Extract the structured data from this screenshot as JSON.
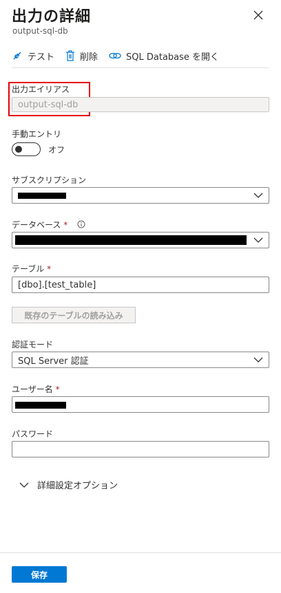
{
  "header": {
    "title": "出力の詳細",
    "subtitle": "output-sql-db"
  },
  "toolbar": {
    "test_label": "テスト",
    "delete_label": "削除",
    "open_db_label": "SQL Database を開く"
  },
  "output_alias": {
    "label": "出力エイリアス",
    "value": "output-sql-db"
  },
  "manual_entry": {
    "label": "手動エントリ",
    "state": "オフ"
  },
  "subscription": {
    "label": "サブスクリプション"
  },
  "database": {
    "label": "データベース",
    "required": "*"
  },
  "table": {
    "label": "テーブル",
    "required": "*",
    "value": "[dbo].[test_table]"
  },
  "load_table_button": "既存のテーブルの読み込み",
  "auth_mode": {
    "label": "認証モード",
    "value": "SQL Server 認証"
  },
  "username": {
    "label": "ユーザー名",
    "required": "*"
  },
  "password": {
    "label": "パスワード"
  },
  "advanced": {
    "label": "詳細設定オプション"
  },
  "footer": {
    "save_label": "保存"
  },
  "colors": {
    "accent": "#0078d4",
    "highlight": "#e60000",
    "required": "#a4262c"
  }
}
